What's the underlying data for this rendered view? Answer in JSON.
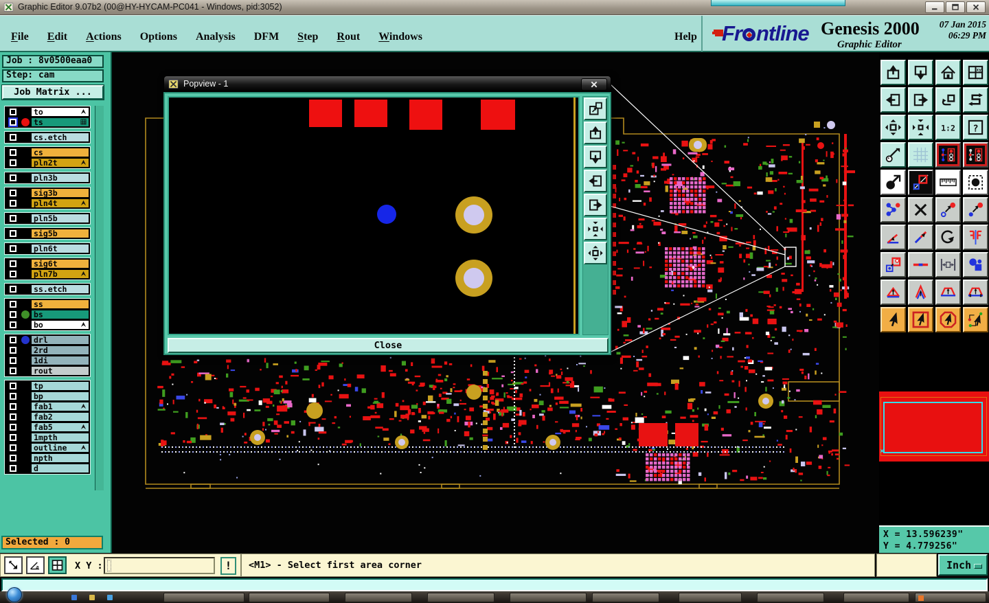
{
  "window": {
    "title": "Graphic Editor 9.07b2 (00@HY-HYCAM-PC041 - Windows, pid:3052)"
  },
  "menu": {
    "items": [
      {
        "label": "File",
        "u": 0
      },
      {
        "label": "Edit",
        "u": 0
      },
      {
        "label": "Actions",
        "u": 0
      },
      {
        "label": "Options",
        "u": -1
      },
      {
        "label": "Analysis",
        "u": -1
      },
      {
        "label": "DFM",
        "u": -1
      },
      {
        "label": "Step",
        "u": 0
      },
      {
        "label": "Rout",
        "u": 0
      },
      {
        "label": "Windows",
        "u": 0
      }
    ],
    "help": "Help"
  },
  "brand": {
    "logo": "Frontline",
    "product": "Genesis 2000",
    "date": "07 Jan 2015",
    "time": "06:29 PM",
    "subtitle": "Graphic Editor"
  },
  "job": {
    "job_label": "Job : 8v0500eaa0",
    "step_label": "Step: cam",
    "matrix_button": "Job Matrix ..."
  },
  "layers": {
    "groups": [
      [
        {
          "label": "to",
          "bg": "#ffffff",
          "glyph": "arrow"
        },
        {
          "label": "ts",
          "bg": "#17997a",
          "dot": "#e81010",
          "glyph": "grid",
          "checkbox": "blue"
        }
      ],
      [
        {
          "label": "cs.etch",
          "bg": "#b9dce0"
        }
      ],
      [
        {
          "label": "cs",
          "bg": "#f0b13c"
        },
        {
          "label": "pln2t",
          "bg": "#d2a312",
          "glyph": "arrow"
        }
      ],
      [
        {
          "label": "pln3b",
          "bg": "#b9dce0"
        }
      ],
      [
        {
          "label": "sig3b",
          "bg": "#f0b13c"
        },
        {
          "label": "pln4t",
          "bg": "#d2a312",
          "glyph": "arrow"
        }
      ],
      [
        {
          "label": "pln5b",
          "bg": "#b9dce0"
        }
      ],
      [
        {
          "label": "sig5b",
          "bg": "#f0b13c"
        }
      ],
      [
        {
          "label": "pln6t",
          "bg": "#b9dce0"
        }
      ],
      [
        {
          "label": "sig6t",
          "bg": "#f0b13c"
        },
        {
          "label": "pln7b",
          "bg": "#d2a312",
          "glyph": "arrow"
        }
      ],
      [
        {
          "label": "ss.etch",
          "bg": "#b9dce0"
        }
      ],
      [
        {
          "label": "ss",
          "bg": "#f0b13c"
        },
        {
          "label": "bs",
          "bg": "#17997a",
          "dot": "#3f8f28"
        },
        {
          "label": "bo",
          "bg": "#ffffff",
          "glyph": "arrow"
        }
      ],
      [
        {
          "label": "drl",
          "bg": "#93b3bb",
          "dot": "#2333cc"
        },
        {
          "label": "2rd",
          "bg": "#93b3bb"
        },
        {
          "label": "1di",
          "bg": "#93b3bb"
        },
        {
          "label": "rout",
          "bg": "#c4cccc"
        }
      ],
      [
        {
          "label": "tp",
          "bg": "#a6d8d8"
        },
        {
          "label": "bp",
          "bg": "#a6d8d8"
        },
        {
          "label": "fab1",
          "bg": "#a6d8d8",
          "glyph": "arrow"
        },
        {
          "label": "fab2",
          "bg": "#a6d8d8"
        },
        {
          "label": "fab5",
          "bg": "#a6d8d8",
          "glyph": "arrow"
        },
        {
          "label": "1mpth",
          "bg": "#a6d8d8"
        },
        {
          "label": "outline",
          "bg": "#a6d8d8",
          "glyph": "arrow"
        },
        {
          "label": "npth",
          "bg": "#a6d8d8"
        },
        {
          "label": "d",
          "bg": "#a6d8d8"
        }
      ]
    ]
  },
  "popview": {
    "title": "Popview - 1",
    "close_button": "Close",
    "side_buttons": [
      "popout-window-icon",
      "pan-up-icon",
      "pan-down-icon",
      "pan-left-icon",
      "pan-right-icon",
      "zoom-fit-icon",
      "zoom-expand-icon"
    ]
  },
  "toolbar": {
    "buttons": [
      {
        "name": "pan-up-icon",
        "style": "teal"
      },
      {
        "name": "pan-down-icon",
        "style": "teal"
      },
      {
        "name": "home-icon",
        "style": "teal"
      },
      {
        "name": "quadrant-xy-icon",
        "style": "teal"
      },
      {
        "name": "pan-left-icon",
        "style": "teal"
      },
      {
        "name": "pan-right-icon",
        "style": "teal"
      },
      {
        "name": "zoom-previous-icon",
        "style": "teal"
      },
      {
        "name": "s-path-icon",
        "style": "teal"
      },
      {
        "name": "zoom-expand-icon",
        "style": "teal"
      },
      {
        "name": "zoom-fit-icon",
        "style": "teal"
      },
      {
        "name": "zoom-ratio-icon",
        "style": "teal"
      },
      {
        "name": "help-icon",
        "style": "teal"
      },
      {
        "name": "tools-palette-icon",
        "style": "teal"
      },
      {
        "name": "grid-icon",
        "style": "teal"
      },
      {
        "name": "layer-colors-a-icon",
        "style": "redframe"
      },
      {
        "name": "layer-colors-b-icon",
        "style": "redframe"
      },
      {
        "name": "move-element-icon",
        "style": "white"
      },
      {
        "name": "zoom-area-icon",
        "style": "black"
      },
      {
        "name": "measure-ruler-icon",
        "style": "white"
      },
      {
        "name": "select-filter-icon",
        "style": "white"
      },
      {
        "name": "chain-select-icon",
        "style": "gray"
      },
      {
        "name": "delete-x-icon",
        "style": "gray"
      },
      {
        "name": "copy-circle-icon",
        "style": "gray"
      },
      {
        "name": "copy-dot-icon",
        "style": "gray"
      },
      {
        "name": "angle-measure-icon",
        "style": "gray"
      },
      {
        "name": "slant-line-icon",
        "style": "gray"
      },
      {
        "name": "rotate-icon",
        "style": "gray"
      },
      {
        "name": "mirror-ff-icon",
        "style": "gray"
      },
      {
        "name": "copy-pad-icon",
        "style": "gray"
      },
      {
        "name": "segment-icon",
        "style": "gray"
      },
      {
        "name": "spacing-icon",
        "style": "gray"
      },
      {
        "name": "surface-shapes-icon",
        "style": "gray"
      },
      {
        "name": "arrow-triangle-icon",
        "style": "gray"
      },
      {
        "name": "arrow-chevron-icon",
        "style": "gray"
      },
      {
        "name": "arrow-trapezoid-icon",
        "style": "gray"
      },
      {
        "name": "arrow-trapezoid-ticks-icon",
        "style": "gray"
      },
      {
        "name": "cursor-icon",
        "style": "orange"
      },
      {
        "name": "cursor-box-icon",
        "style": "orange"
      },
      {
        "name": "cursor-octagon-icon",
        "style": "orange"
      },
      {
        "name": "cursor-net-icon",
        "style": "orange"
      }
    ]
  },
  "coords": {
    "x": "X = 13.596239\"",
    "y": "Y = 4.779256\""
  },
  "status": {
    "selected": "Selected : 0",
    "xy_label": "X Y :",
    "xy_value": "",
    "exclaim": "!",
    "prompt": "<M1> - Select first area corner",
    "units": "Inch",
    "left_buttons": [
      "diagonal-arrow-icon",
      "angle-alpha-icon",
      "grid-table-icon"
    ]
  },
  "colors": {
    "teal_panel": "#4cc4a4",
    "menubar": "#a9ded5",
    "pcb_red": "#e81010",
    "pcb_gold": "#c8a020",
    "selected_orange": "#f2a93d",
    "prompt_yellow": "#fbf6d2",
    "brand_blue": "#181890",
    "brand_red": "#d42010"
  }
}
